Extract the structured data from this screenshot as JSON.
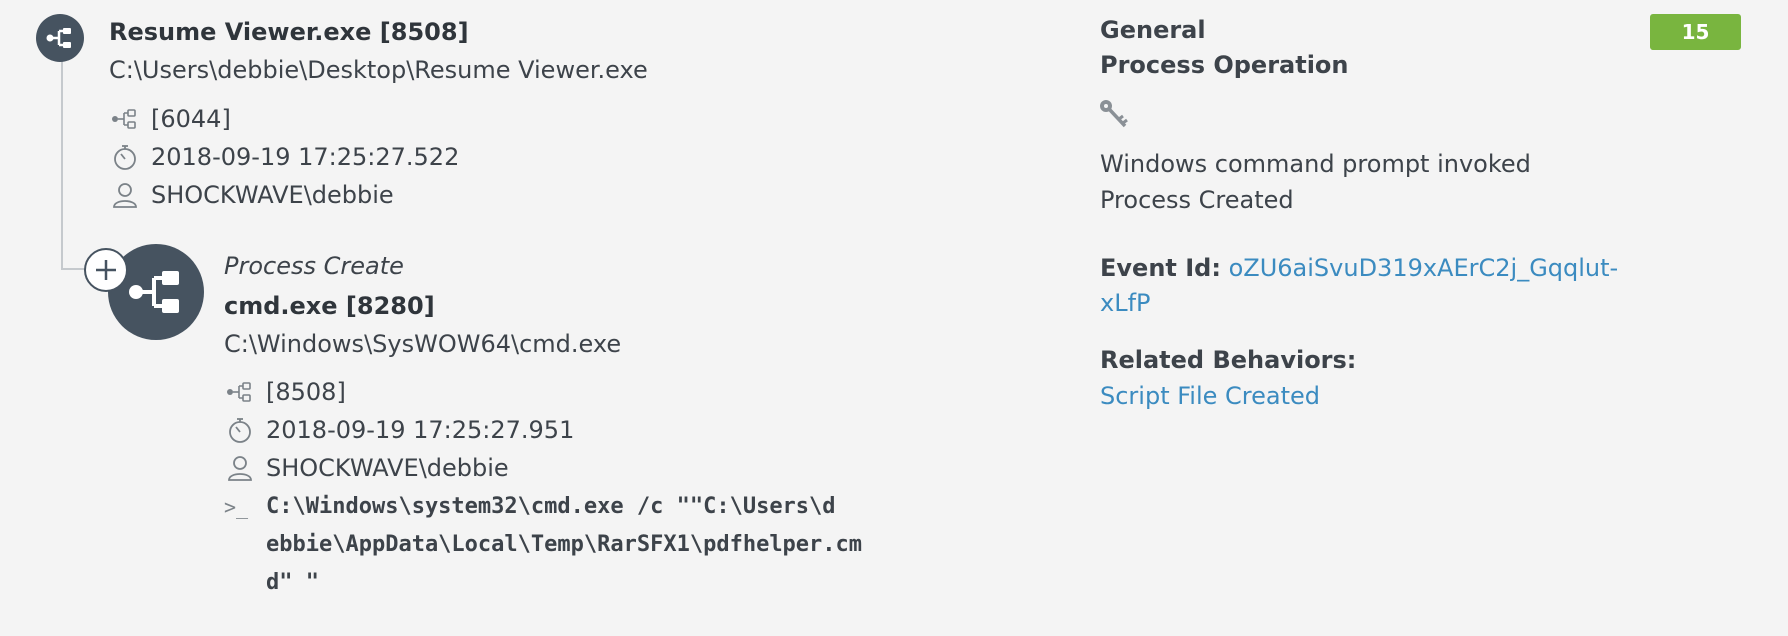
{
  "parent": {
    "name": "Resume Viewer.exe [8508]",
    "path": "C:\\Users\\debbie\\Desktop\\Resume Viewer.exe",
    "ppid": "[6044]",
    "timestamp": "2018-09-19 17:25:27.522",
    "user": "SHOCKWAVE\\debbie"
  },
  "child": {
    "operation": "Process Create",
    "name": "cmd.exe [8280]",
    "path": "C:\\Windows\\SysWOW64\\cmd.exe",
    "ppid": "[8508]",
    "timestamp": "2018-09-19 17:25:27.951",
    "user": "SHOCKWAVE\\debbie",
    "cmd_prompt": ">_",
    "cmdline_lines": [
      "C:\\Windows\\system32\\cmd.exe /c \"\"C:\\Users\\d",
      "ebbie\\AppData\\Local\\Temp\\RarSFX1\\pdfhelper.cm",
      "d\" \""
    ]
  },
  "details": {
    "category": "General",
    "operation_type": "Process Operation",
    "key_icon": "key-icon",
    "description_line1": "Windows command prompt invoked",
    "description_line2": "Process Created",
    "event_id_label": "Event Id:",
    "event_id_value_line1": "oZU6aiSvuD319xAErC2j_Gqqlut-",
    "event_id_value_line2": "xLfP",
    "related_label": "Related Behaviors:",
    "related_link": "Script File Created",
    "score": "15"
  },
  "colors": {
    "node": "#465360",
    "link": "#3b8bc0",
    "badge": "#79b53f",
    "background": "#f4f4f4"
  },
  "icons": {
    "process_node": "process-tree-icon",
    "ppid": "branch-icon",
    "time": "stopwatch-icon",
    "user": "user-icon",
    "expand": "plus-icon"
  }
}
